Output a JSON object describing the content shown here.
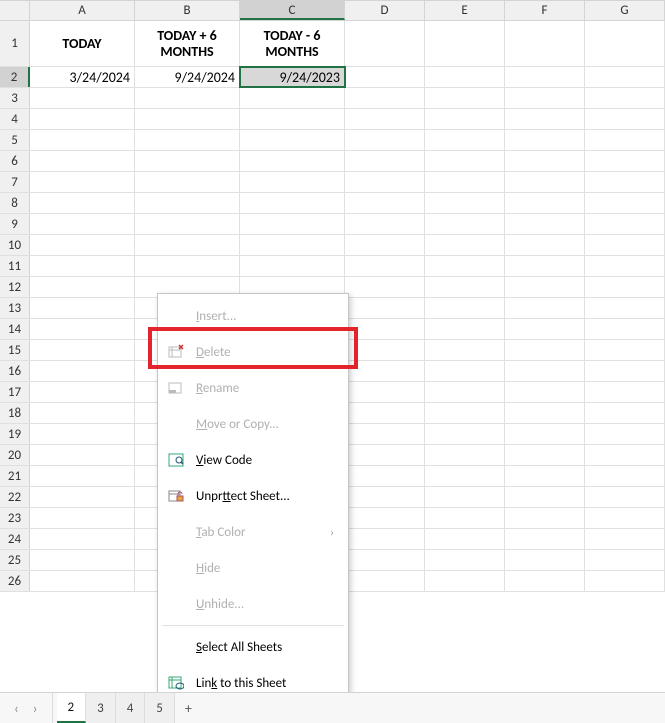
{
  "columns": [
    "A",
    "B",
    "C",
    "D",
    "E",
    "F",
    "G"
  ],
  "headers": {
    "A": "TODAY",
    "B": "TODAY + 6 MONTHS",
    "C": "TODAY - 6 MONTHS"
  },
  "row2": {
    "A": "3/24/2024",
    "B": "9/24/2024",
    "C": "9/24/2023"
  },
  "selected_cell": "C2",
  "row_numbers": [
    1,
    2,
    3,
    4,
    5,
    6,
    7,
    8,
    9,
    10,
    11,
    12,
    13,
    14,
    15,
    16,
    17,
    18,
    19,
    20,
    21,
    22,
    23,
    24,
    25,
    26
  ],
  "context_menu": {
    "insert": "Insert...",
    "delete": "Delete",
    "rename": "Rename",
    "move_copy": "Move or Copy...",
    "view_code": "View Code",
    "unprotect": "Unprotect Sheet...",
    "tab_color": "Tab Color",
    "hide": "Hide",
    "unhide": "Unhide...",
    "select_all": "Select All Sheets",
    "link_sheet": "Link to this Sheet"
  },
  "tabs": {
    "active": "2",
    "others": [
      "3",
      "4",
      "5"
    ]
  },
  "chart_data": {
    "type": "table",
    "columns": [
      "TODAY",
      "TODAY + 6 MONTHS",
      "TODAY - 6 MONTHS"
    ],
    "rows": [
      [
        "3/24/2024",
        "9/24/2024",
        "9/24/2023"
      ]
    ]
  }
}
